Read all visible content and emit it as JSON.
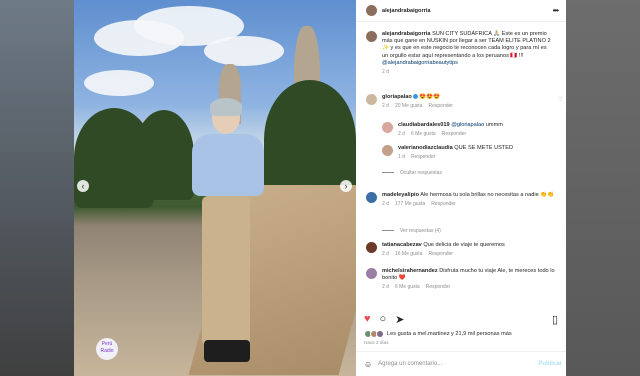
{
  "author": {
    "username": "alejandrabaigorria"
  },
  "caption": {
    "username": "alejandrabaigorria",
    "text": "SUN CITY SUDÁFRICA 🙏🏼 Este es un premio más que gane en NUSKIN por llegar a ser TEAM ELITE PLATINO 2 ✨ y es que en este negocio te reconocen cada logro y para mí es un orgullo estar aquí representando a los peruanos 🇵🇪 !!! ",
    "mention": "@alejandrabaigorriabeautytips",
    "time": "2 d"
  },
  "comments": [
    {
      "user": "gloriapalao",
      "verified": true,
      "text": "😍😍😍",
      "time": "2 d",
      "likes": "20 Me gusta",
      "reply": "Responder"
    },
    {
      "user": "claudiabardales019",
      "mention": "@gloriapalao",
      "text": "ummm",
      "time": "2 d",
      "likes": "6 Me gusta",
      "reply": "Responder"
    },
    {
      "user": "valerianodiazclaudia",
      "text": "QUE SE METE USTED",
      "time": "1 d",
      "reply": "Responder"
    },
    {
      "user": "madeleyalipio",
      "text": "Ale hermosa tu sola brillas no necesitas a nadie 👏👏",
      "time": "2 d",
      "likes": "177 Me gusta",
      "reply": "Responder"
    },
    {
      "user": "tatianacabezav",
      "text": "Que delicia de viaje te queremos",
      "time": "2 d",
      "likes": "16 Me gusta",
      "reply": "Responder"
    },
    {
      "user": "michelsirahernandez",
      "text": "Disfruta mucho tu viaje Ale, te mereces todo lo bonito ❤️",
      "time": "2 d",
      "likes": "6 Me gusta",
      "reply": "Responder"
    }
  ],
  "hide_replies": "Ocultar respuestas",
  "view_replies": "Ver respuestas (4)",
  "likes_summary": "Les gusta a mel.martinez y 21,9 mil personas más",
  "posted_ago": "Hace 2 días",
  "add_comment_placeholder": "Agrega un comentario...",
  "publish_label": "Publicar",
  "watermark": "Perú Radio",
  "icons": [
    "heart-icon",
    "comment-icon",
    "share-icon",
    "bookmark-icon",
    "more-icon",
    "smile-icon"
  ],
  "colors": {
    "link": "#00376b",
    "liked": "#ed4956",
    "publish": "#b2dffc"
  }
}
